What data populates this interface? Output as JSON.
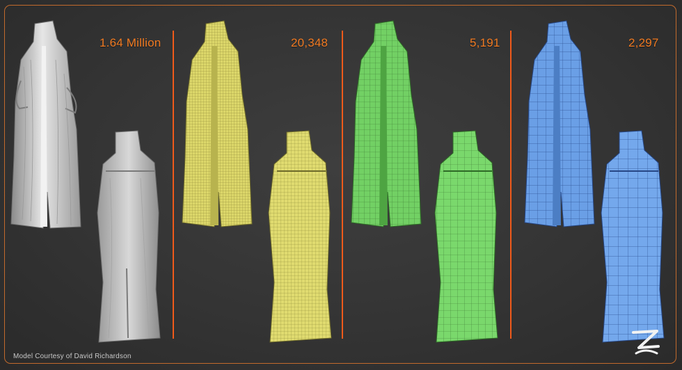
{
  "panels": [
    {
      "count": "1.64 Million",
      "color": "#d8d8d8",
      "grid": false
    },
    {
      "count": "20,348",
      "color": "#e6e070",
      "grid": true
    },
    {
      "count": "5,191",
      "color": "#7ad86c",
      "grid": true
    },
    {
      "count": "2,297",
      "color": "#6aa0e8",
      "grid": true
    }
  ],
  "credit": "Model Courtesy of David Richardson",
  "logo_icon": "zbrush-logo-icon",
  "accent_color": "#f07a22",
  "divider_color": "#f05a1a"
}
